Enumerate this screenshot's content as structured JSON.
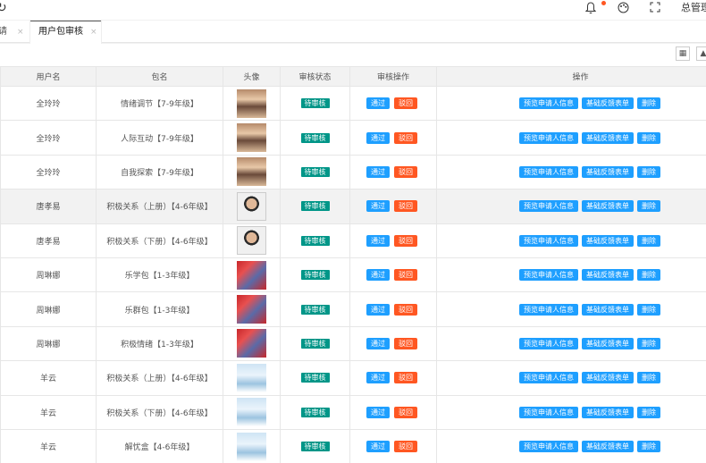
{
  "header": {
    "user": "总管理",
    "icons": [
      "refresh-icon",
      "bell-icon",
      "skin-icon",
      "fullscreen-icon"
    ],
    "notification_dot_color": "#ff5722"
  },
  "tabs": [
    {
      "label": "请",
      "close": "×"
    },
    {
      "label": "用户包审核",
      "close": "×",
      "active": true
    }
  ],
  "table": {
    "columns": [
      "用户名",
      "包名",
      "头像",
      "审核状态",
      "审核操作",
      "操作"
    ],
    "rows": [
      {
        "user": "全玲玲",
        "package": "情绪调节【7-9年级】",
        "status": "待审核",
        "avatar": "p1"
      },
      {
        "user": "全玲玲",
        "package": "人际互动【7-9年级】",
        "status": "待审核",
        "avatar": "p1"
      },
      {
        "user": "全玲玲",
        "package": "自我探索【7-9年级】",
        "status": "待审核",
        "avatar": "p1"
      },
      {
        "user": "唐孝易",
        "package": "积极关系（上册）【4-6年级】",
        "status": "待审核",
        "avatar": "p2"
      },
      {
        "user": "唐孝易",
        "package": "积极关系（下册）【4-6年级】",
        "status": "待审核",
        "avatar": "p2"
      },
      {
        "user": "周琳娜",
        "package": "乐学包【1-3年级】",
        "status": "待审核",
        "avatar": "p3"
      },
      {
        "user": "周琳娜",
        "package": "乐群包【1-3年级】",
        "status": "待审核",
        "avatar": "p3"
      },
      {
        "user": "周琳娜",
        "package": "积极情绪【1-3年级】",
        "status": "待审核",
        "avatar": "p3"
      },
      {
        "user": "羊云",
        "package": "积极关系（上册）【4-6年级】",
        "status": "待审核",
        "avatar": "p4"
      },
      {
        "user": "羊云",
        "package": "积极关系（下册）【4-6年级】",
        "status": "待审核",
        "avatar": "p4"
      },
      {
        "user": "羊云",
        "package": "解忧盒【4-6年级】",
        "status": "待审核",
        "avatar": "p4"
      }
    ],
    "audit_buttons": {
      "approve": "通过",
      "reject": "驳回"
    },
    "op_buttons": {
      "preview": "预览申请人信息",
      "feedback": "基础反馈表单",
      "delete": "删除"
    }
  },
  "colors": {
    "badge": "#009688",
    "primary": "#1e9fff",
    "danger": "#ff5722"
  }
}
